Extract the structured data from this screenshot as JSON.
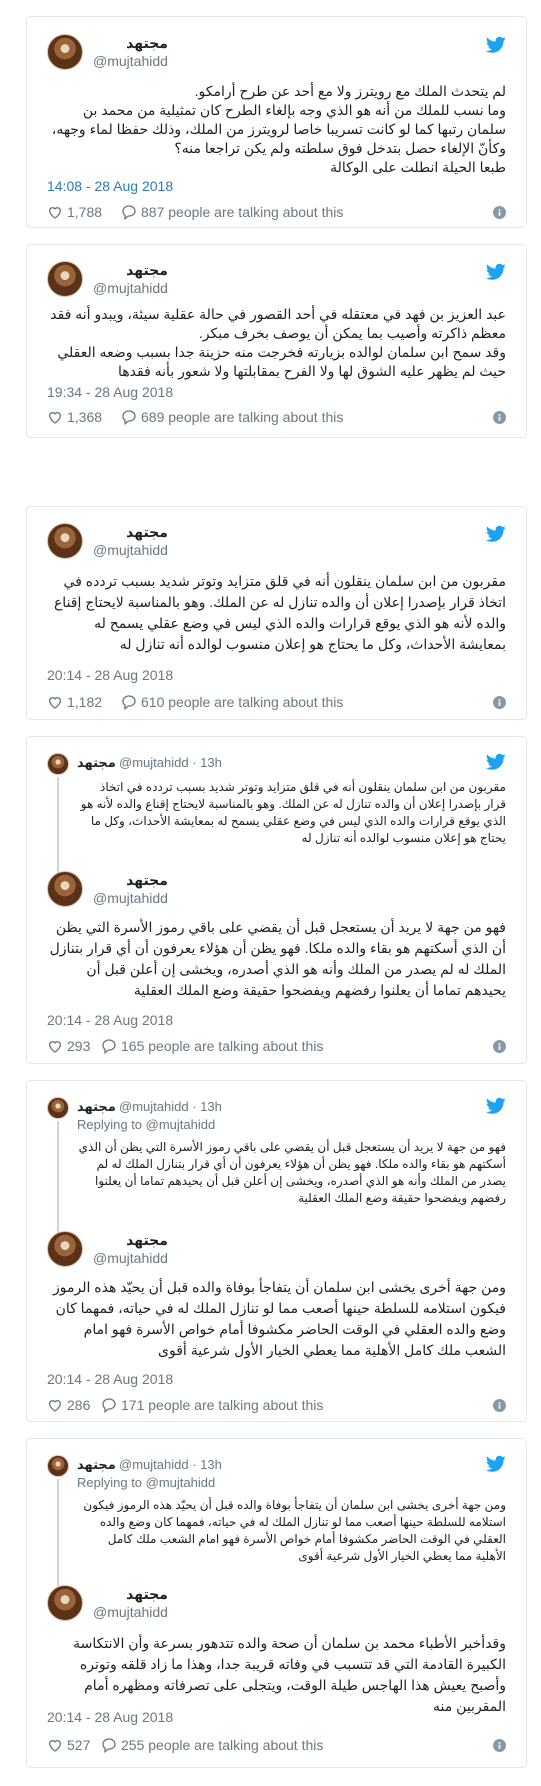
{
  "author": {
    "name": "مجتهد",
    "handle": "@mujtahidd"
  },
  "parent_meta": "· 13h",
  "replying": "Replying to @mujtahidd",
  "brand": {
    "twitter_blue": "#1da1f2",
    "link_blue": "#2b7bb9"
  },
  "tweets": [
    {
      "text": "لم يتحدث الملك مع رويترز ولا مع أحد عن طرح أرامكو.\nوما نسب للملك من أنه هو الذي وجه بإلغاء الطرح كان تمثيلية من محمد بن سلمان رتبها كما لو كانت تسريبا خاصا لرويترز من الملك، وذلك حفظا لماء وجهه، وكأنّ الإلغاء حصل بتدخل فوق سلطته ولم يكن تراجعا منه؟\nطبعا الحيلة انطلت على الوكالة",
      "time": "14:08 - 28 Aug 2018",
      "likes": "1,788",
      "talking": "887 people are talking about this"
    },
    {
      "text": "عبد العزيز بن فهد في معتقله في أحد القصور في حالة عقلية سيئة، ويبدو أنه فقد معظم ذاكرته وأصيب بما يمكن أن يوصف بخرف مبكر.\nوقد سمح ابن سلمان لوالده بزيارته فخرجت منه حزينة جدا بسبب وضعه العقلي حيث لم يظهر عليه الشوق لها ولا الفرح بمقابلتها ولا شعور بأنه فقدها",
      "time": "19:34 - 28 Aug 2018",
      "likes": "1,368",
      "talking": "689 people are talking about this"
    },
    {
      "text": "مقربون من ابن سلمان ينقلون أنه في قلق متزايد وتوتر شديد بسبب تردده في اتخاذ قرار بإصدرا إعلان أن والده تنازل له عن الملك. وهو بالمناسبة لايحتاج إقناع والده لأنه هو الذي يوقع قرارات والده الذي ليس في وضع عقلي يسمح له بمعايشة الأحداث، وكل ما يحتاج هو إعلان منسوب لوالده أنه تنازل له",
      "time": "20:14 - 28 Aug 2018",
      "likes": "1,182",
      "talking": "610 people are talking about this"
    },
    {
      "parent_text": "مقربون من ابن سلمان ينقلون أنه في قلق متزايد وتوتر شديد بسبب تردده في اتخاذ قرار بإصدرا إعلان أن والده تنازل له عن الملك. وهو بالمناسبة لايحتاج إقناع والده لأنه هو الذي يوقع قرارات والده الذي ليس في وضع عقلي يسمح له بمعايشة الأحداث، وكل ما يحتاج هو إعلان منسوب لوالده أنه تنازل له",
      "text": "فهو من جهة لا يريد أن يستعجل قبل أن يقضي على باقي رموز الأسرة التي يظن أن الذي أسكتهم هو بقاء والده ملكا. فهو يظن أن هؤلاء يعرفون أن أي قرار بتنازل الملك له لم يصدر من الملك وأنه هو الذي أصدره، ويخشى إن أعلن قبل أن يحيدهم تماما أن يعلنوا رفضهم ويفضحوا حقيقة وضع الملك العقلية",
      "time": "20:14 - 28 Aug 2018",
      "likes": "293",
      "talking": "165 people are talking about this"
    },
    {
      "parent_text": "فهو من جهة لا يريد أن يستعجل قبل أن يقضي على باقي رموز الأسرة التي يظن أن الذي أسكتهم هو بقاء والده ملكا. فهو يظن أن هؤلاء يعرفون أن أي قرار بتنازل الملك له لم يصدر من الملك وأنه هو الذي أصدره، ويخشى إن أعلن قبل أن يحيدهم تماما أن يعلنوا رفضهم ويفضحوا حقيقة وضع الملك العقلية",
      "text": "ومن جهة أخرى يخشى ابن سلمان أن يتفاجأ بوفاة والده قبل أن يحيّد هذه الرموز فيكون استلامه للسلطة حينها أصعب مما لو تنازل الملك له في حياته، فمهما كان وضع والده العقلي في الوقت الحاضر مكشوفا أمام خواص الأسرة فهو امام الشعب ملك كامل الأهلية مما يعطي الخيار الأول شرعية أقوى",
      "time": "20:14 - 28 Aug 2018",
      "likes": "286",
      "talking": "171 people are talking about this"
    },
    {
      "parent_text": "ومن جهة أخرى يخشى ابن سلمان أن يتفاجأ بوفاة والده قبل أن يحيّد هذه الرموز فيكون استلامه للسلطة حينها أصعب مما لو تنازل الملك له في حياته، فمهما كان وضع والده العقلي في الوقت الحاضر مكشوفا أمام خواص الأسرة فهو امام الشعب ملك كامل الأهلية مما يعطي الخيار الأول شرعية أقوى",
      "text": "وقدأخبر الأطباء محمد بن سلمان أن صحة والده تتدهور بسرعة وأن الانتكاسة الكبيرة القادمة التي قد تتسبب في وفاته قريبة جدا، وهذا ما زاد قلقه وتوتره وأصبح يعيش هذا الهاجس طيلة الوقت، ويتجلى على تصرفاته ومظهره أمام المقربين منه",
      "time": "20:14 - 28 Aug 2018",
      "likes": "527",
      "talking": "255 people are talking about this"
    }
  ]
}
